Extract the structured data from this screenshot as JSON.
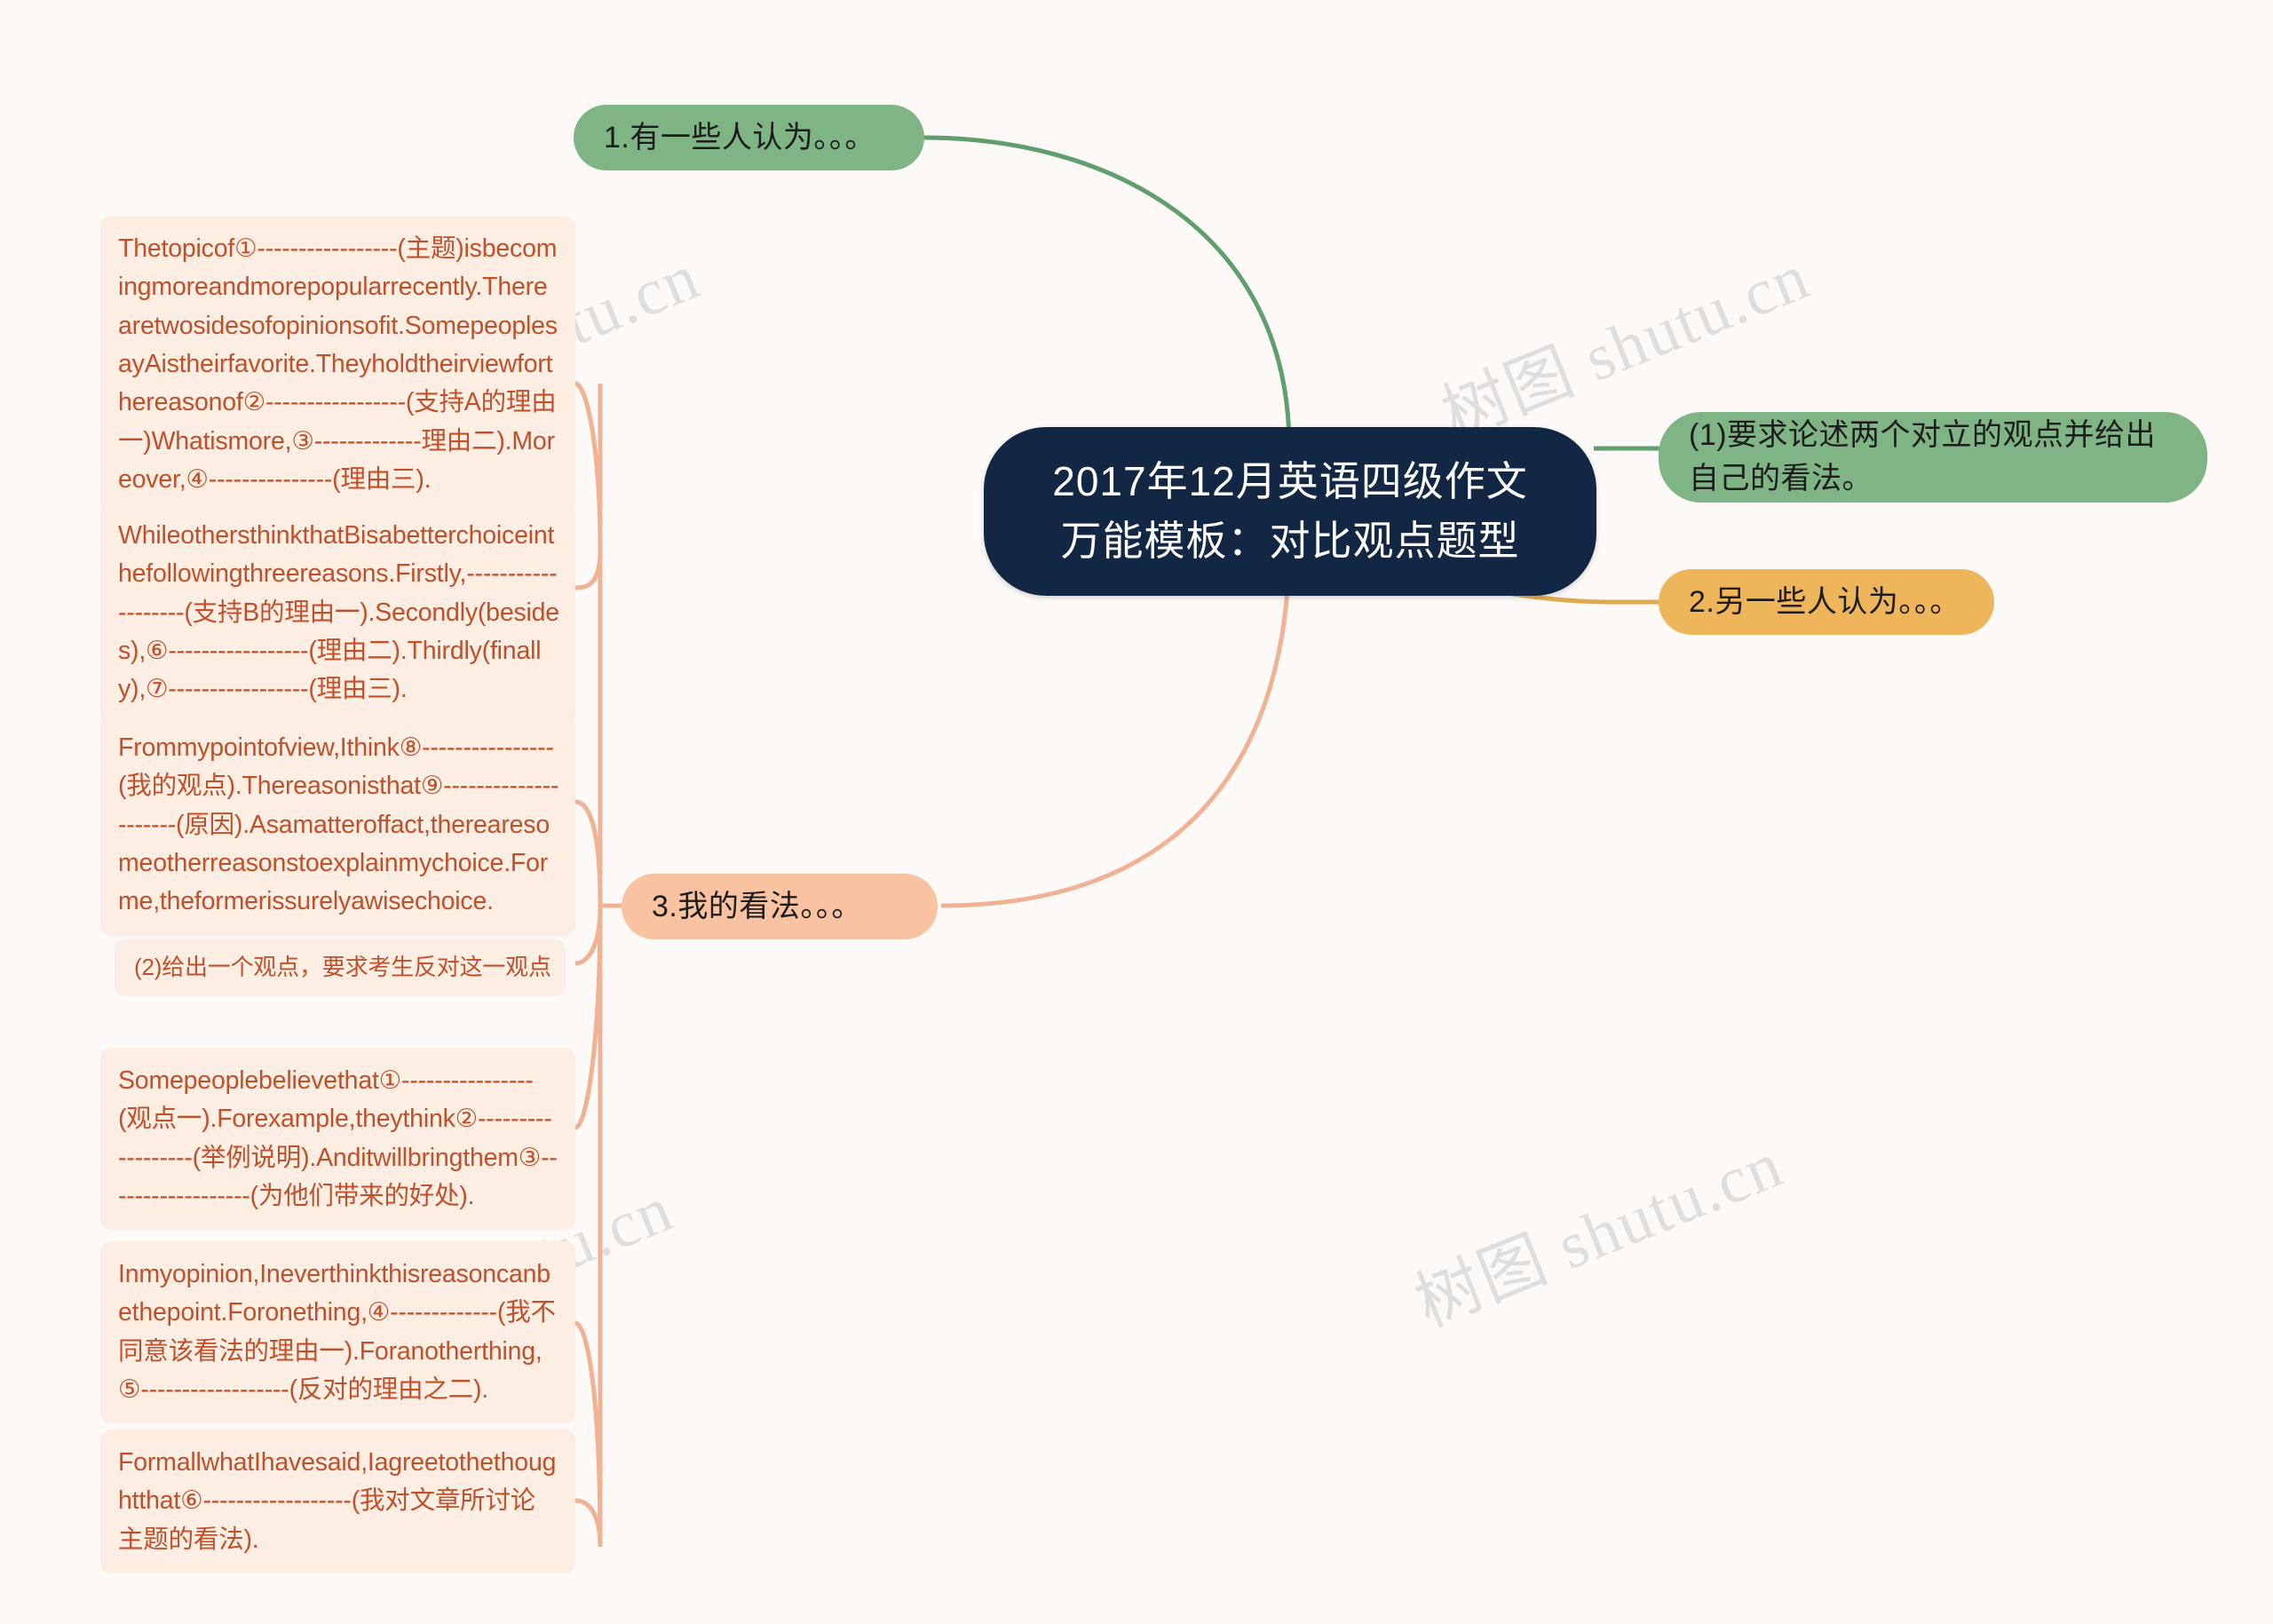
{
  "canvas": {
    "background": "#fdf9f6"
  },
  "watermark": {
    "text": "树图 shutu.cn",
    "color": "#c9c9c9"
  },
  "colors": {
    "central_bg": "#122743",
    "central_text": "#ffffff",
    "green": "#7fb484",
    "orange": "#efb55b",
    "peach": "#f9c2a0",
    "leaf_bg": "#fdeee4",
    "leaf_text": "#c1502a",
    "wire_green": "#5f9e6d",
    "wire_orange": "#e0a94e",
    "wire_peach": "#f0b293"
  },
  "central": {
    "title": "2017年12月英语四级作文\n万能模板：对比观点题型"
  },
  "branches": {
    "branch1": {
      "label": "1.有一些人认为。。。",
      "color": "#7fb484",
      "children": [
        {
          "id": "leaf-1",
          "text": "Thetopicof①-----------------(主题)isbecomingmoreandmorepopularrecently.Therearetwosidesofopinionsofit.SomepeoplesayAistheirfavorite.Theyholdtheirviewforthereasonof②-----------------(支持A的理由一)Whatismore,③-------------理由二).Moreover,④---------------(理由三)."
        },
        {
          "id": "leaf-2",
          "text": "WhileothersthinkthatBisabetterchoiceinthefollowingthreereasons.Firstly,-------------------(支持B的理由一).Secondly(besides),⑥-----------------(理由二).Thirdly(finally),⑦-----------------(理由三)."
        },
        {
          "id": "leaf-3",
          "text": "Frommypointofview,Ithink⑧----------------(我的观点).Thereasonisthat⑨---------------------(原因).Asamatteroffact,therearesomeotherreasonstoexplainmychoice.Forme,theformerissurelyawisechoice."
        }
      ]
    },
    "branch2": {
      "label": "(1)要求论述两个对立的观点并给出\n自己的看法。",
      "color": "#7fb484"
    },
    "branch3": {
      "label": "2.另一些人认为。。。",
      "color": "#efb55b"
    },
    "branch4": {
      "label": "3.我的看法。。。",
      "color": "#f9c2a0",
      "children": [
        {
          "id": "leaf-4",
          "text": "(2)给出一个观点，要求考生反对这一观点"
        },
        {
          "id": "leaf-5",
          "text": "Somepeoplebelievethat①----------------(观点一).Forexample,theythink②------------------(举例说明).Anditwillbringthem③------------------(为他们带来的好处)."
        },
        {
          "id": "leaf-6",
          "text": "Inmyopinion,Ineverthinkthisreasoncanbethepoint.Foronething,④-------------(我不同意该看法的理由一).Foranotherthing,⑤------------------(反对的理由之二)."
        },
        {
          "id": "leaf-7",
          "text": "FormallwhatIhavesaid,Iagreetothethoughtthat⑥------------------(我对文章所讨论主题的看法)."
        }
      ]
    }
  }
}
